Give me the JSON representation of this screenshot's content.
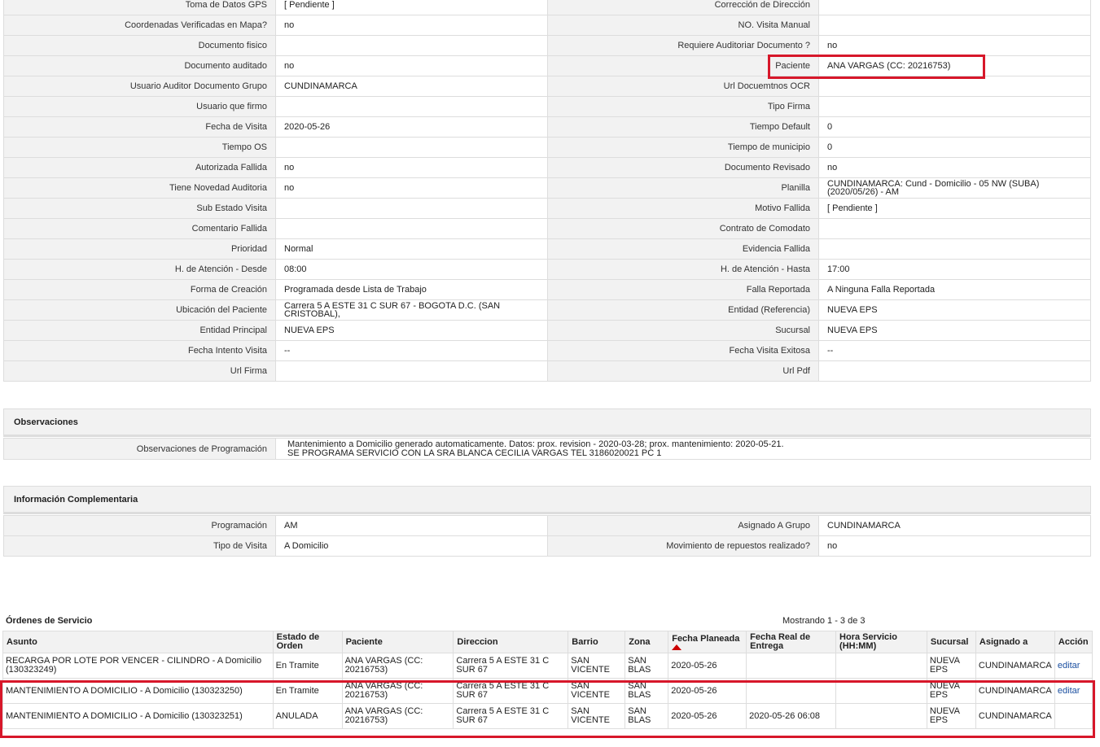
{
  "details": {
    "rows": [
      {
        "l1": "Toma de Datos GPS",
        "v1": "[ Pendiente ]",
        "l2": "Corrección de Dirección",
        "v2": ""
      },
      {
        "l1": "Coordenadas Verificadas en Mapa?",
        "v1": "no",
        "l2": "NO. Visita Manual",
        "v2": ""
      },
      {
        "l1": "Documento fisico",
        "v1": "",
        "l2": "Requiere Auditoriar Documento ?",
        "v2": "no"
      },
      {
        "l1": "Documento auditado",
        "v1": "no",
        "l2": "Paciente",
        "v2": "ANA VARGAS (CC: 20216753)"
      },
      {
        "l1": "Usuario Auditor Documento Grupo",
        "v1": "CUNDINAMARCA",
        "l2": "Url Docuemtnos OCR",
        "v2": ""
      },
      {
        "l1": "Usuario que firmo",
        "v1": "",
        "l2": "Tipo Firma",
        "v2": ""
      },
      {
        "l1": "Fecha de Visita",
        "v1": "2020-05-26",
        "l2": "Tiempo Default",
        "v2": "0"
      },
      {
        "l1": "Tiempo OS",
        "v1": "",
        "l2": "Tiempo de municipio",
        "v2": "0"
      },
      {
        "l1": "Autorizada Fallida",
        "v1": "no",
        "l2": "Documento Revisado",
        "v2": "no"
      },
      {
        "l1": "Tiene Novedad Auditoria",
        "v1": "no",
        "l2": "Planilla",
        "v2": "CUNDINAMARCA: Cund - Domicilio - 05 NW (SUBA) (2020/05/26) - AM"
      },
      {
        "l1": "Sub Estado Visita",
        "v1": "",
        "l2": "Motivo Fallida",
        "v2": "[ Pendiente ]"
      },
      {
        "l1": "Comentario Fallida",
        "v1": "",
        "l2": "Contrato de Comodato",
        "v2": ""
      },
      {
        "l1": "Prioridad",
        "v1": "Normal",
        "l2": "Evidencia Fallida",
        "v2": ""
      },
      {
        "l1": "H. de Atención - Desde",
        "v1": "08:00",
        "l2": "H. de Atención - Hasta",
        "v2": "17:00"
      },
      {
        "l1": "Forma de Creación",
        "v1": "Programada desde Lista de Trabajo",
        "l2": "Falla Reportada",
        "v2": "A Ninguna Falla Reportada"
      },
      {
        "l1": "Ubicación del Paciente",
        "v1": "Carrera 5 A ESTE 31 C SUR 67 - BOGOTA D.C. (SAN CRISTOBAL),",
        "l2": "Entidad (Referencia)",
        "v2": "NUEVA EPS"
      },
      {
        "l1": "Entidad Principal",
        "v1": "NUEVA EPS",
        "l2": "Sucursal",
        "v2": "NUEVA EPS"
      },
      {
        "l1": "Fecha Intento Visita",
        "v1": "--",
        "l2": "Fecha Visita Exitosa",
        "v2": "--"
      },
      {
        "l1": "Url Firma",
        "v1": "",
        "l2": "Url Pdf",
        "v2": ""
      }
    ]
  },
  "observaciones": {
    "title": "Observaciones",
    "label": "Observaciones de Programación",
    "line1": "Mantenimiento a Domicilio generado automaticamente. Datos: prox. revision - 2020-03-28; prox. mantenimiento: 2020-05-21.",
    "line2": "SE PROGRAMA SERVICIO CON LA SRA BLANCA CECILIA VARGAS TEL 3186020021 PC 1"
  },
  "complementaria": {
    "title": "Información Complementaria",
    "rows": [
      {
        "l1": "Programación",
        "v1": "AM",
        "l2": "Asignado A Grupo",
        "v2": "CUNDINAMARCA"
      },
      {
        "l1": "Tipo de Visita",
        "v1": "A Domicilio",
        "l2": "Movimiento de repuestos realizado?",
        "v2": "no"
      }
    ]
  },
  "ordenes": {
    "title": "Órdenes de Servicio",
    "count_text": "Mostrando 1 - 3 de 3",
    "headers": [
      "Asunto",
      "Estado de Orden",
      "Paciente",
      "Direccion",
      "Barrio",
      "Zona",
      "Fecha Planeada",
      "Fecha Real de Entrega",
      "Hora Servicio (HH:MM)",
      "Sucursal",
      "Asignado a",
      "Acción"
    ],
    "rows": [
      [
        "RECARGA POR LOTE POR VENCER - CILINDRO - A Domicilio (130323249)",
        "En Tramite",
        "ANA VARGAS (CC: 20216753)",
        "Carrera 5 A ESTE 31 C SUR 67",
        "SAN VICENTE",
        "SAN BLAS",
        "2020-05-26",
        "",
        "",
        "NUEVA EPS",
        "CUNDINAMARCA",
        "editar"
      ],
      [
        "MANTENIMIENTO A DOMICILIO - A Domicilio (130323250)",
        "En Tramite",
        "ANA VARGAS (CC: 20216753)",
        "Carrera 5 A ESTE 31 C SUR 67",
        "SAN VICENTE",
        "SAN BLAS",
        "2020-05-26",
        "",
        "",
        "NUEVA EPS",
        "CUNDINAMARCA",
        "editar"
      ],
      [
        "MANTENIMIENTO A DOMICILIO - A Domicilio (130323251)",
        "ANULADA",
        "ANA VARGAS (CC: 20216753)",
        "Carrera 5 A ESTE 31 C SUR 67",
        "SAN VICENTE",
        "SAN BLAS",
        "2020-05-26",
        "2020-05-26 06:08",
        "",
        "NUEVA EPS",
        "CUNDINAMARCA",
        ""
      ]
    ]
  },
  "colors": {
    "highlight": "#d7172a",
    "link": "#1a4fa0"
  }
}
